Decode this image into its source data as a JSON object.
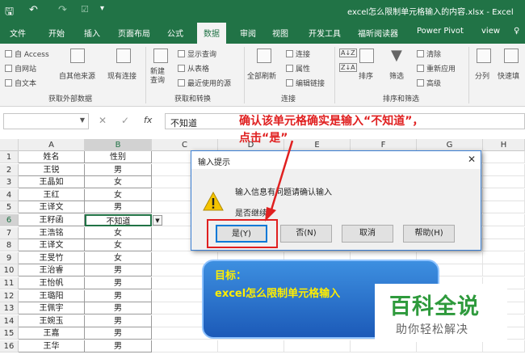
{
  "window": {
    "title": "excel怎么限制单元格输入的内容.xlsx - Excel"
  },
  "tabs": [
    "文件",
    "开始",
    "插入",
    "页面布局",
    "公式",
    "数据",
    "审阅",
    "视图",
    "开发工具",
    "福昕阅读器",
    "Power Pivot",
    "view"
  ],
  "active_tab": "数据",
  "ribbon": {
    "get_external": {
      "items": [
        "自 Access",
        "自网站",
        "自文本"
      ],
      "other": "自其他来源",
      "existing": "现有连接",
      "label": "获取外部数据"
    },
    "transform": {
      "new_query": "新建\n查询",
      "items": [
        "显示查询",
        "从表格",
        "最近使用的源"
      ],
      "label": "获取和转换"
    },
    "connections": {
      "refresh": "全部刷新",
      "items": [
        "连接",
        "属性",
        "编辑链接"
      ],
      "label": "连接"
    },
    "sort_filter": {
      "sort_az": "A↓Z",
      "sort_za": "Z↓A",
      "sort": "排序",
      "filter": "筛选",
      "items": [
        "清除",
        "重新应用",
        "高级"
      ],
      "label": "排序和筛选"
    },
    "tools": {
      "split": "分列",
      "fill": "快速填"
    }
  },
  "formula_bar": {
    "cancel": "✕",
    "confirm": "✓",
    "fx": "fx",
    "value": "不知道"
  },
  "columns": [
    "A",
    "B",
    "C",
    "D",
    "E",
    "F",
    "G",
    "H"
  ],
  "rows": [
    {
      "n": "1",
      "a": "姓名",
      "b": "性别"
    },
    {
      "n": "2",
      "a": "王锐",
      "b": "男"
    },
    {
      "n": "3",
      "a": "王晶如",
      "b": "女"
    },
    {
      "n": "4",
      "a": "王红",
      "b": "女"
    },
    {
      "n": "5",
      "a": "王译文",
      "b": "男"
    },
    {
      "n": "6",
      "a": "王籽函",
      "b": "不知道"
    },
    {
      "n": "7",
      "a": "王浩铭",
      "b": "女"
    },
    {
      "n": "8",
      "a": "王译文",
      "b": "女"
    },
    {
      "n": "9",
      "a": "王旻竹",
      "b": "女"
    },
    {
      "n": "10",
      "a": "王治睿",
      "b": "男"
    },
    {
      "n": "11",
      "a": "王怡帆",
      "b": "男"
    },
    {
      "n": "12",
      "a": "王璐阳",
      "b": "男"
    },
    {
      "n": "13",
      "a": "王佩宇",
      "b": "男"
    },
    {
      "n": "14",
      "a": "王婉玉",
      "b": "男"
    },
    {
      "n": "15",
      "a": "王嘉",
      "b": "男"
    },
    {
      "n": "16",
      "a": "王华",
      "b": "男"
    }
  ],
  "dialog": {
    "title": "输入提示",
    "message": "输入信息有问题请确认输入",
    "question": "是否继续?",
    "yes": "是(Y)",
    "no": "否(N)",
    "cancel": "取消",
    "help": "帮助(H)"
  },
  "annotation": {
    "line1": "确认该单元格确实是输入“不知道”，",
    "line2": "点击“是”"
  },
  "goal": {
    "label": "目标：",
    "text": "excel怎么限制单元格输入"
  },
  "brand": {
    "name": "百科全说",
    "slogan": "助你轻松解决"
  },
  "colors": {
    "excel_green": "#217346",
    "annotation_red": "#e02020",
    "goal_blue": "#2a6fd0",
    "goal_text": "#ffee00",
    "brand_green": "#2e9a3c"
  }
}
